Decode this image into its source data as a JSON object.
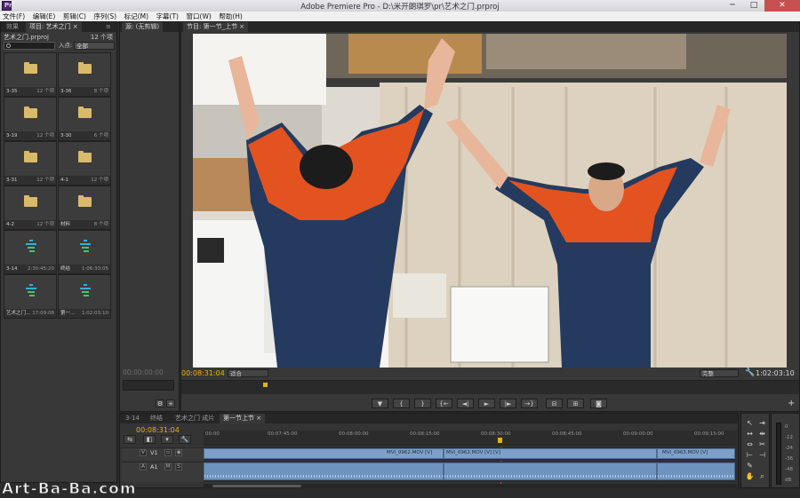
{
  "window": {
    "title": "Adobe Premiere Pro - D:\\米开朗琪罗\\pr\\艺术之门.prproj",
    "minimize": "─",
    "maximize": "□",
    "close": "✕"
  },
  "menu": [
    "文件(F)",
    "编辑(E)",
    "剪辑(C)",
    "序列(S)",
    "标记(M)",
    "字幕(T)",
    "窗口(W)",
    "帮助(H)"
  ],
  "project_panel": {
    "tabs": [
      "效果",
      "项目: 艺术之门 ×"
    ],
    "project_name": "艺术之门.prproj",
    "item_count": "12 个项",
    "search_placeholder": "",
    "in_label": "入点:",
    "in_value": "全部",
    "items": [
      {
        "type": "folder",
        "name": "3-35",
        "count": "12 个项"
      },
      {
        "type": "folder",
        "name": "3-36",
        "count": "8 个项"
      },
      {
        "type": "folder",
        "name": "3-19",
        "count": "12 个项"
      },
      {
        "type": "folder",
        "name": "3-30",
        "count": "6 个项"
      },
      {
        "type": "folder",
        "name": "3-31",
        "count": "12 个项"
      },
      {
        "type": "folder",
        "name": "4-1",
        "count": "12 个项"
      },
      {
        "type": "folder",
        "name": "4-2",
        "count": "12 个项"
      },
      {
        "type": "folder",
        "name": "材料",
        "count": "8 个项"
      },
      {
        "type": "sequence",
        "name": "3-14",
        "count": "2:30:45:20"
      },
      {
        "type": "sequence",
        "name": "终结",
        "count": "1:06:33:05"
      },
      {
        "type": "sequence",
        "name": "艺术之门...",
        "count": "17:09:08"
      },
      {
        "type": "sequence",
        "name": "第一...",
        "count": "1:02:03:10"
      }
    ]
  },
  "source_panel": {
    "tab": "源: (无剪辑)",
    "timecode": "00:00:00:00"
  },
  "program_panel": {
    "tab": "节目: 第一节_上节 ×",
    "timecode": "00:08:31:04",
    "fit": "适合",
    "quality": "完整",
    "duration": "1:02:03:10",
    "controls": [
      "▼",
      "{",
      "}",
      "{←",
      "◄|",
      "►",
      "|►",
      "→}",
      "⊟",
      "⊞",
      "📷"
    ]
  },
  "timeline_panel": {
    "tabs": [
      "3-14",
      "终结",
      "艺术之门 成片",
      "第一节上节 ×"
    ],
    "timecode": "00:08:31:04",
    "ruler_labels": [
      "00:00",
      "00:07:45:00",
      "00:08:00:00",
      "00:08:15:00",
      "00:08:30:00",
      "00:08:45:00",
      "00:09:00:00",
      "00:09:15:00"
    ],
    "tracks": {
      "v1_label": "V1",
      "a1_label": "A1",
      "clips_v": [
        "MVI_0962.MOV [V]",
        "MVI_0962.MOV [V] [V]",
        "MVI_0963.MOV [V]"
      ],
      "clips_a": [
        "",
        "",
        ""
      ]
    }
  },
  "meter": {
    "scale": [
      "0",
      "-12",
      "-24",
      "-36",
      "-48",
      "dB"
    ]
  },
  "watermark": "Art-Ba-Ba.com",
  "colors": {
    "timecode_yellow": "#e4b400",
    "clip_blue": "#7ea0c8",
    "playhead_red": "#c94a4a"
  }
}
